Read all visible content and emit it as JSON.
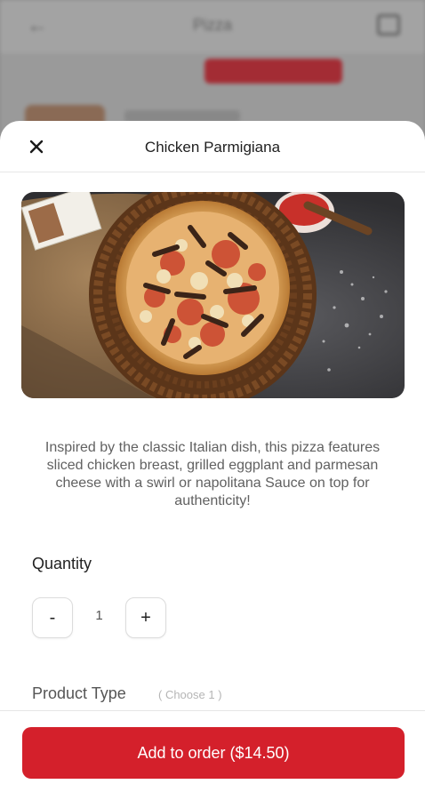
{
  "background": {
    "title": "Pizza",
    "tabs": [
      "",
      "",
      "",
      ""
    ]
  },
  "sheet": {
    "title": "Chicken Parmigiana",
    "description": "Inspired by the classic Italian dish, this pizza features sliced chicken breast, grilled eggplant and parmesan cheese with a swirl or napolitana Sauce on top for authenticity!",
    "quantity": {
      "label": "Quantity",
      "minus_label": "-",
      "value": "1",
      "plus_label": "+"
    },
    "product_type": {
      "label": "Product Type",
      "hint": "( Choose 1 )"
    },
    "add_button_label": "Add to order ($14.50)"
  },
  "colors": {
    "accent": "#d4202b",
    "text_primary": "#1f1f1f",
    "text_secondary": "#616161"
  },
  "icons": {
    "close": "close-icon",
    "back": "back-arrow-icon",
    "cart": "cart-icon"
  }
}
